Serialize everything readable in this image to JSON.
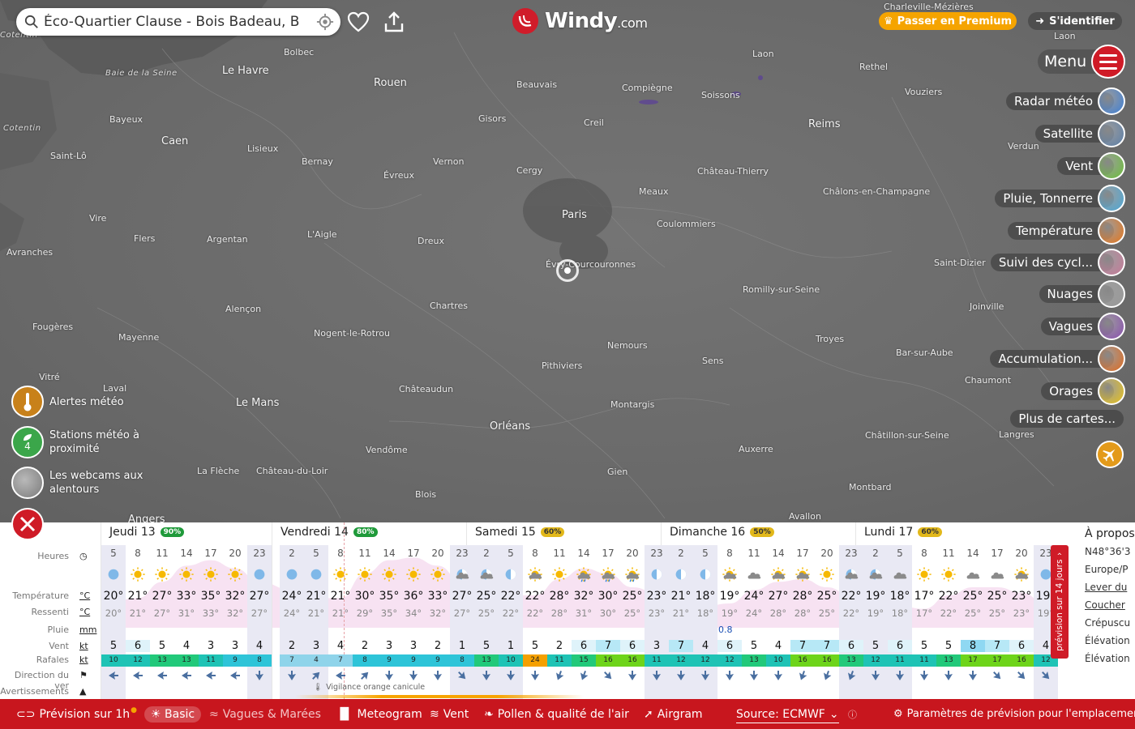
{
  "search": {
    "value": "Éco-Quartier Clause - Bois Badeau, B"
  },
  "logo": {
    "name": "Windy",
    "domain": ".com"
  },
  "header": {
    "premium_label": "Passer en Premium",
    "login_label": "S'identifier"
  },
  "menu": {
    "label": "Menu"
  },
  "layers": [
    {
      "label": "Radar météo",
      "icon": "radar-thumb-icon",
      "color": "#3d7fd6"
    },
    {
      "label": "Satellite",
      "icon": "satellite-thumb-icon",
      "color": "#5c7fa8"
    },
    {
      "label": "Vent",
      "icon": "wind-thumb-icon",
      "color": "#6bbf3a"
    },
    {
      "label": "Pluie, Tonnerre",
      "icon": "rain-thumb-icon",
      "color": "#4aa8d8"
    },
    {
      "label": "Température",
      "icon": "temperature-thumb-icon",
      "color": "#e8761a"
    },
    {
      "label": "Suivi des cycl...",
      "icon": "cyclone-thumb-icon",
      "color": "#c77a9a"
    },
    {
      "label": "Nuages",
      "icon": "clouds-thumb-icon",
      "color": "#9a9a9a"
    },
    {
      "label": "Vagues",
      "icon": "waves-thumb-icon",
      "color": "#8a4fb0"
    },
    {
      "label": "Accumulation...",
      "icon": "accumulation-thumb-icon",
      "color": "#e06a1e"
    },
    {
      "label": "Orages",
      "icon": "storms-thumb-icon",
      "color": "#e8c21a"
    }
  ],
  "more_maps_label": "Plus de cartes...",
  "left_buttons": {
    "alerts": "Alertes météo",
    "stations": "Stations météo à proximité",
    "stations_count": "4",
    "webcams": "Les webcams aux alentours"
  },
  "map": {
    "cities": [
      {
        "name": "Cotentin",
        "cls": "region"
      },
      {
        "name": "Baie de la Seine",
        "cls": "region"
      },
      {
        "name": "Bolbec",
        "cls": ""
      },
      {
        "name": "Le Havre",
        "cls": "big"
      },
      {
        "name": "Rouen",
        "cls": "big"
      },
      {
        "name": "Beauvais",
        "cls": ""
      },
      {
        "name": "Compiègne",
        "cls": ""
      },
      {
        "name": "Soissons",
        "cls": ""
      },
      {
        "name": "Laon",
        "cls": ""
      },
      {
        "name": "Rethel",
        "cls": ""
      },
      {
        "name": "Charleville-Mézières",
        "cls": ""
      },
      {
        "name": "Vouziers",
        "cls": ""
      },
      {
        "name": "Bayeux",
        "cls": ""
      },
      {
        "name": "Caen",
        "cls": "big"
      },
      {
        "name": "Lisieux",
        "cls": ""
      },
      {
        "name": "Gisors",
        "cls": ""
      },
      {
        "name": "Creil",
        "cls": ""
      },
      {
        "name": "Reims",
        "cls": "big"
      },
      {
        "name": "Cotentin",
        "cls": "region"
      },
      {
        "name": "Saint-Lô",
        "cls": ""
      },
      {
        "name": "Bernay",
        "cls": ""
      },
      {
        "name": "Évreux",
        "cls": ""
      },
      {
        "name": "Vernon",
        "cls": ""
      },
      {
        "name": "Cergy",
        "cls": ""
      },
      {
        "name": "Château-Thierry",
        "cls": ""
      },
      {
        "name": "Verdun",
        "cls": ""
      },
      {
        "name": "Meaux",
        "cls": ""
      },
      {
        "name": "Châlons-en-Champagne",
        "cls": ""
      },
      {
        "name": "Paris",
        "cls": "big"
      },
      {
        "name": "Vire",
        "cls": ""
      },
      {
        "name": "Coulommiers",
        "cls": ""
      },
      {
        "name": "Flers",
        "cls": ""
      },
      {
        "name": "Argentan",
        "cls": ""
      },
      {
        "name": "L'Aigle",
        "cls": ""
      },
      {
        "name": "Dreux",
        "cls": ""
      },
      {
        "name": "Avranches",
        "cls": ""
      },
      {
        "name": "Évry-Courcouronnes",
        "cls": ""
      },
      {
        "name": "Saint-Dizier",
        "cls": ""
      },
      {
        "name": "Romilly-sur-Seine",
        "cls": ""
      },
      {
        "name": "Alençon",
        "cls": ""
      },
      {
        "name": "Chartres",
        "cls": ""
      },
      {
        "name": "Joinville",
        "cls": ""
      },
      {
        "name": "Fougères",
        "cls": ""
      },
      {
        "name": "Mayenne",
        "cls": ""
      },
      {
        "name": "Nogent-le-Rotrou",
        "cls": ""
      },
      {
        "name": "Nemours",
        "cls": ""
      },
      {
        "name": "Troyes",
        "cls": ""
      },
      {
        "name": "Bar-sur-Aube",
        "cls": ""
      },
      {
        "name": "Sens",
        "cls": ""
      },
      {
        "name": "Pithiviers",
        "cls": ""
      },
      {
        "name": "Vitré",
        "cls": ""
      },
      {
        "name": "Laval",
        "cls": ""
      },
      {
        "name": "Châteaudun",
        "cls": ""
      },
      {
        "name": "Chaumont",
        "cls": ""
      },
      {
        "name": "Le Mans",
        "cls": "big"
      },
      {
        "name": "Montargis",
        "cls": ""
      },
      {
        "name": "Orléans",
        "cls": "big"
      },
      {
        "name": "Langres",
        "cls": ""
      },
      {
        "name": "Châtillon-sur-Seine",
        "cls": ""
      },
      {
        "name": "Vendôme",
        "cls": ""
      },
      {
        "name": "Auxerre",
        "cls": ""
      },
      {
        "name": "La Flèche",
        "cls": ""
      },
      {
        "name": "Château-du-Loir",
        "cls": ""
      },
      {
        "name": "Gien",
        "cls": ""
      },
      {
        "name": "Blois",
        "cls": ""
      },
      {
        "name": "Montbard",
        "cls": ""
      },
      {
        "name": "Angers",
        "cls": "big"
      },
      {
        "name": "Avallon",
        "cls": ""
      },
      {
        "name": "Laon",
        "cls": ""
      }
    ]
  },
  "forecast": {
    "row_labels": {
      "hours": "Heures",
      "temp": "Température",
      "temp_unit": "°C",
      "feels": "Ressenti",
      "feels_unit": "°C",
      "rain": "Pluie",
      "rain_unit": "mm",
      "wind": "Vent",
      "wind_unit": "kt",
      "gusts": "Rafales",
      "gusts_unit": "kt",
      "direction": "Direction du ver",
      "warnings": "Avertissements"
    },
    "days": [
      {
        "name": "Jeudi 13",
        "badge": "90%",
        "badge_color": "#1f9a3a"
      },
      {
        "name": "Vendredi 14",
        "badge": "80%",
        "badge_color": "#1f9a3a"
      },
      {
        "name": "Samedi 15",
        "badge": "60%",
        "badge_color": "#e2b81a"
      },
      {
        "name": "Dimanche 16",
        "badge": "50%",
        "badge_color": "#e2b81a"
      },
      {
        "name": "Lundi 17",
        "badge": "60%",
        "badge_color": "#e2b81a"
      }
    ],
    "hours": [
      "5",
      "8",
      "11",
      "14",
      "17",
      "20",
      "23",
      "2",
      "5",
      "8",
      "11",
      "14",
      "17",
      "20",
      "23",
      "2",
      "5",
      "8",
      "11",
      "14",
      "17",
      "20",
      "23",
      "2",
      "5",
      "8",
      "11",
      "14",
      "17",
      "20",
      "23",
      "2",
      "5",
      "8",
      "11",
      "14",
      "17",
      "20",
      "23"
    ],
    "icons": [
      "moon-clear",
      "sun",
      "sun",
      "sun",
      "sun",
      "sun",
      "moon-clear",
      "moon-clear",
      "moon-clear",
      "sun",
      "sun",
      "sun",
      "sun",
      "sun",
      "moon-cloud",
      "moon-cloud",
      "moon-half",
      "sun-cloud",
      "sun",
      "sun-rain",
      "sun-rain",
      "sun-rain",
      "moon-half",
      "moon-half",
      "moon-half",
      "sun-cloud",
      "cloud",
      "sun-cloud",
      "sun-cloud",
      "sun",
      "moon-cloud",
      "moon-cloud",
      "cloud",
      "sun",
      "sun",
      "cloud",
      "cloud",
      "sun-cloud",
      "moon-clear"
    ],
    "temps": [
      "20°",
      "21°",
      "27°",
      "33°",
      "35°",
      "32°",
      "27°",
      "24°",
      "21°",
      "21°",
      "30°",
      "35°",
      "36°",
      "33°",
      "27°",
      "25°",
      "22°",
      "22°",
      "28°",
      "32°",
      "30°",
      "25°",
      "23°",
      "21°",
      "18°",
      "19°",
      "24°",
      "27°",
      "28°",
      "25°",
      "22°",
      "19°",
      "18°",
      "17°",
      "22°",
      "25°",
      "25°",
      "23°",
      "19°"
    ],
    "feels": [
      "20°",
      "21°",
      "27°",
      "31°",
      "33°",
      "32°",
      "27°",
      "24°",
      "21°",
      "21°",
      "29°",
      "35°",
      "34°",
      "32°",
      "27°",
      "25°",
      "22°",
      "22°",
      "28°",
      "31°",
      "30°",
      "25°",
      "23°",
      "21°",
      "18°",
      "19°",
      "24°",
      "28°",
      "28°",
      "25°",
      "22°",
      "19°",
      "18°",
      "17°",
      "22°",
      "25°",
      "25°",
      "23°",
      "19°"
    ],
    "rain_value": "0.8",
    "wind": [
      "5",
      "6",
      "5",
      "4",
      "3",
      "3",
      "4",
      "2",
      "3",
      "4",
      "2",
      "3",
      "3",
      "2",
      "1",
      "5",
      "1",
      "5",
      "2",
      "6",
      "7",
      "6",
      "3",
      "7",
      "4",
      "6",
      "5",
      "4",
      "7",
      "7",
      "6",
      "5",
      "6",
      "5",
      "5",
      "8",
      "7",
      "6",
      "4"
    ],
    "gusts": [
      "10",
      "12",
      "13",
      "13",
      "11",
      "9",
      "8",
      "7",
      "4",
      "7",
      "8",
      "9",
      "9",
      "9",
      "8",
      "13",
      "10",
      "24",
      "11",
      "15",
      "16",
      "16",
      "11",
      "12",
      "12",
      "12",
      "13",
      "10",
      "16",
      "16",
      "13",
      "12",
      "11",
      "11",
      "13",
      "17",
      "17",
      "16",
      "12"
    ],
    "directions": [
      270,
      270,
      270,
      270,
      270,
      270,
      180,
      180,
      45,
      270,
      45,
      180,
      180,
      180,
      135,
      180,
      180,
      180,
      200,
      200,
      135,
      180,
      180,
      180,
      180,
      180,
      180,
      180,
      200,
      200,
      200,
      180,
      180,
      180,
      180,
      180,
      135,
      135,
      135
    ],
    "warning_text": "Vigilance orange canicule",
    "tab_14_days": "prévision sur 14 jours",
    "info": {
      "title": "À propos",
      "coords": "N48°36'3",
      "timezone": "Europe/P",
      "sunrise": "Lever du",
      "sunset": "Coucher",
      "dusk": "Crépuscu",
      "elevation1": "Élévation",
      "elevation2": "Élévation"
    }
  },
  "bottombar": {
    "forecast_1h": "Prévision sur 1h",
    "basic": "Basic",
    "waves": "Vagues & Marées",
    "meteogram": "Meteogram",
    "wind": "Vent",
    "pollen": "Pollen & qualité de l'air",
    "airgram": "Airgram",
    "source": "Source: ECMWF",
    "settings": "Paramètres de prévision pour l'emplacement"
  },
  "colors": {
    "accent": "#cf1b27",
    "premium": "#f5a400",
    "night_col": "#e9e9f4"
  }
}
